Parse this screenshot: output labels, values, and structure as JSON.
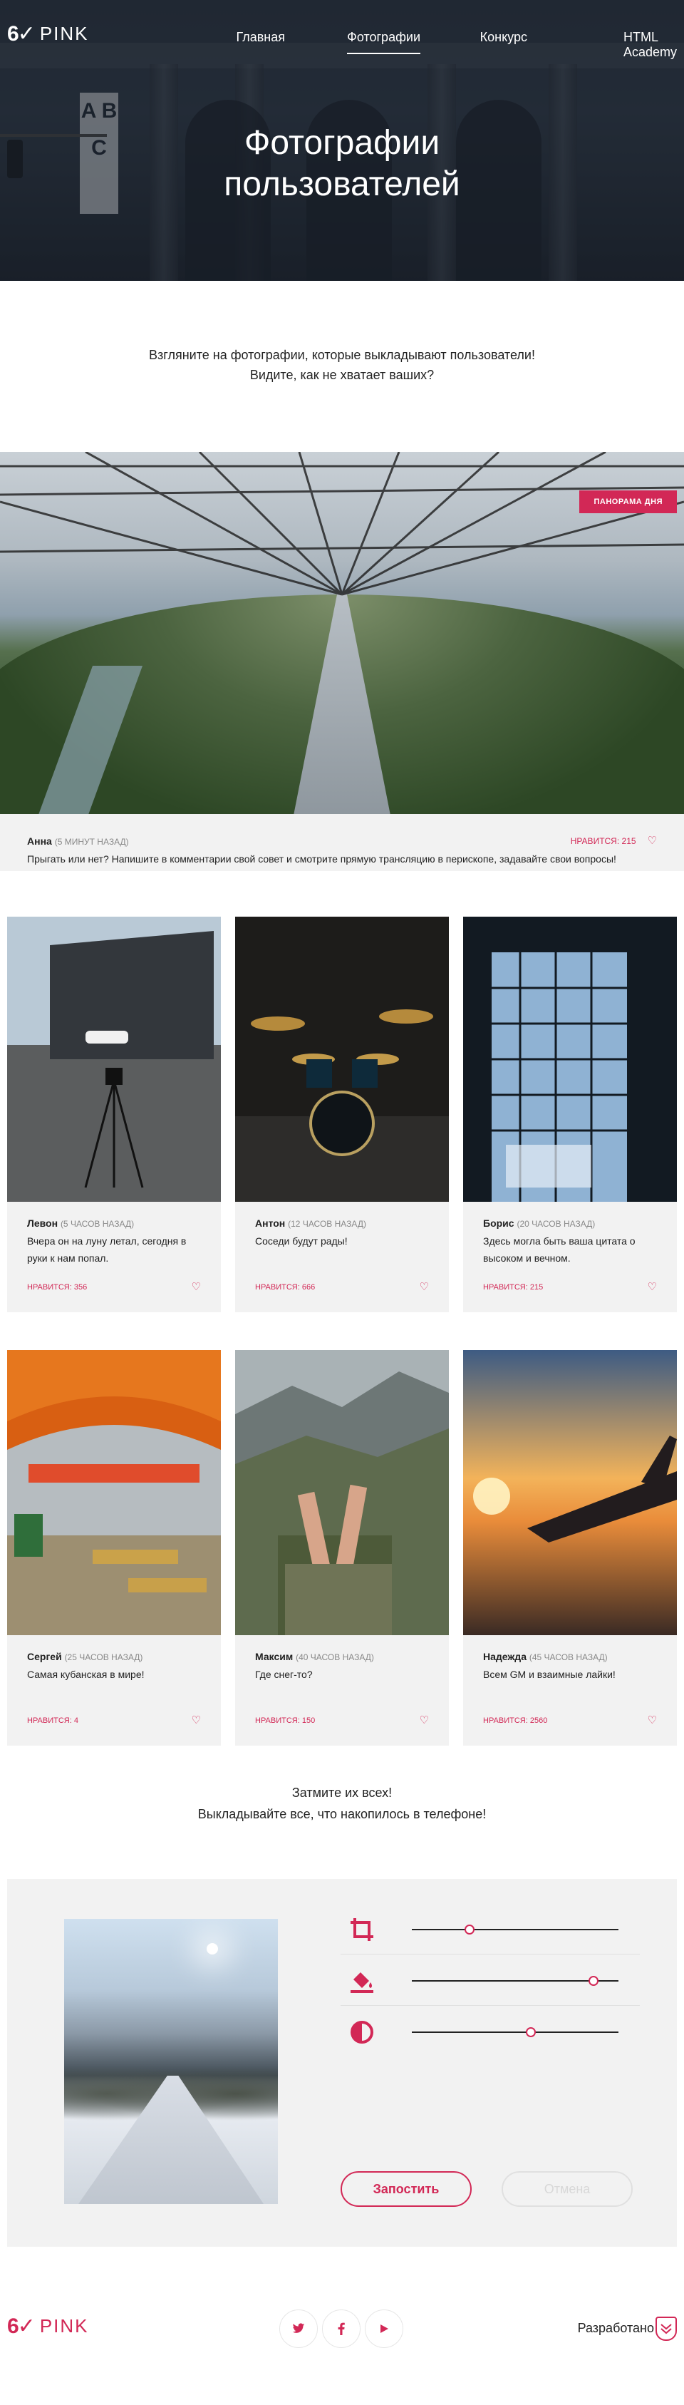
{
  "header": {
    "logo_glyph": "6✓",
    "logo_word": "PINK",
    "nav": [
      {
        "label": "Главная"
      },
      {
        "label": "Фотографии"
      },
      {
        "label": "Конкурс"
      },
      {
        "label": "HTML Academy"
      }
    ],
    "title_line1": "Фотографии",
    "title_line2": "пользователей",
    "sign_letters": "A B C"
  },
  "intro": {
    "line1": "Взгляните на фотографии, которые выкладывают пользователи!",
    "line2": "Видите, как не хватает ваших?"
  },
  "panorama": {
    "badge": "ПАНОРАМА ДНЯ",
    "author": "Анна",
    "time": "(5 МИНУТ НАЗАД)",
    "text": "Прыгать или нет? Напишите в комментарии свой совет и смотрите прямую трансляцию в перископе, задавайте свои вопросы!",
    "likes": "НРАВИТСЯ: 215"
  },
  "cards": [
    {
      "author": "Левон",
      "time": "(5 ЧАСОВ НАЗАД)",
      "text": "Вчера он на луну летал, сегодня в руки к нам попал.",
      "likes": "НРАВИТСЯ: 356"
    },
    {
      "author": "Антон",
      "time": "(12 ЧАСОВ НАЗАД)",
      "text": "Соседи будут рады!",
      "likes": "НРАВИТСЯ: 666"
    },
    {
      "author": "Борис",
      "time": "(20 ЧАСОВ НАЗАД)",
      "text": "Здесь могла быть ваша цитата о высоком и вечном.",
      "likes": "НРАВИТСЯ: 215"
    },
    {
      "author": "Сергей",
      "time": "(25 ЧАСОВ НАЗАД)",
      "text": "Самая кубанская в мире!",
      "likes": "НРАВИТСЯ: 4"
    },
    {
      "author": "Максим",
      "time": "(40 ЧАСОВ НАЗАД)",
      "text": "Где снег-то?",
      "likes": "НРАВИТСЯ: 150"
    },
    {
      "author": "Надежда",
      "time": "(45 ЧАСОВ НАЗАД)",
      "text": "Всем GM и взаимные лайки!",
      "likes": "НРАВИТСЯ: 2560"
    }
  ],
  "cta": {
    "line1": "Затмите их всех!",
    "line2": "Выкладывайте все, что накопилось в телефоне!"
  },
  "editor": {
    "controls": [
      {
        "icon": "crop-icon",
        "level": 0.26
      },
      {
        "icon": "fill-icon",
        "level": 0.88
      },
      {
        "icon": "contrast-icon",
        "level": 0.57
      }
    ],
    "submit": "Запостить",
    "cancel": "Отмена"
  },
  "footer": {
    "logo_glyph": "6✓",
    "logo_word": "PINK",
    "social": [
      "twitter-icon",
      "facebook-icon",
      "youtube-icon"
    ],
    "made_by": "Разработано"
  },
  "colors": {
    "accent": "#d22856",
    "card_bg": "#f2f2f2"
  }
}
